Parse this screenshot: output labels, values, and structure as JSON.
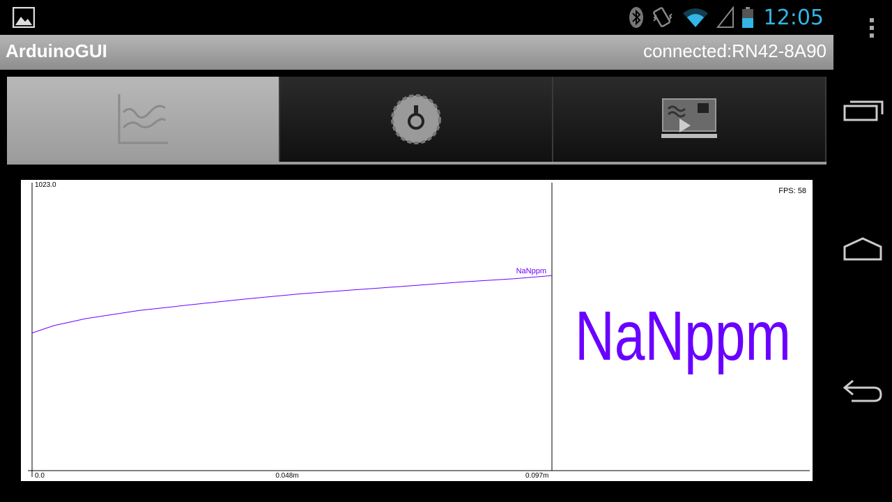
{
  "status": {
    "time": "12:05",
    "icons": [
      "gallery-icon",
      "bluetooth-icon",
      "vibrate-icon",
      "wifi-icon",
      "signal-icon",
      "battery-icon"
    ],
    "accent": "#33b5e5"
  },
  "app": {
    "title": "ArduinoGUI",
    "connection": "connected:RN42-8A90"
  },
  "tabs": [
    {
      "icon": "graph-icon",
      "active": true
    },
    {
      "icon": "knob-icon",
      "active": false
    },
    {
      "icon": "terminal-icon",
      "active": false
    }
  ],
  "fps": "FPS: 58",
  "big_reading": "NaNppm",
  "chart_data": {
    "type": "line",
    "ylim": [
      0,
      1023.0
    ],
    "y_top_label": "1023.0",
    "x_ticks": [
      "0.0",
      "0.048m",
      "0.097m"
    ],
    "series": [
      {
        "name": "NaNppm",
        "color": "#6a00ff",
        "x": [
          0,
          0.004,
          0.01,
          0.02,
          0.03,
          0.04,
          0.05,
          0.06,
          0.07,
          0.08,
          0.09,
          0.097
        ],
        "y": [
          489,
          515,
          540,
          569,
          590,
          610,
          628,
          642,
          656,
          670,
          682,
          693
        ]
      }
    ]
  },
  "nav": [
    "overflow-menu-icon",
    "recent-apps-icon",
    "home-icon",
    "back-icon"
  ]
}
